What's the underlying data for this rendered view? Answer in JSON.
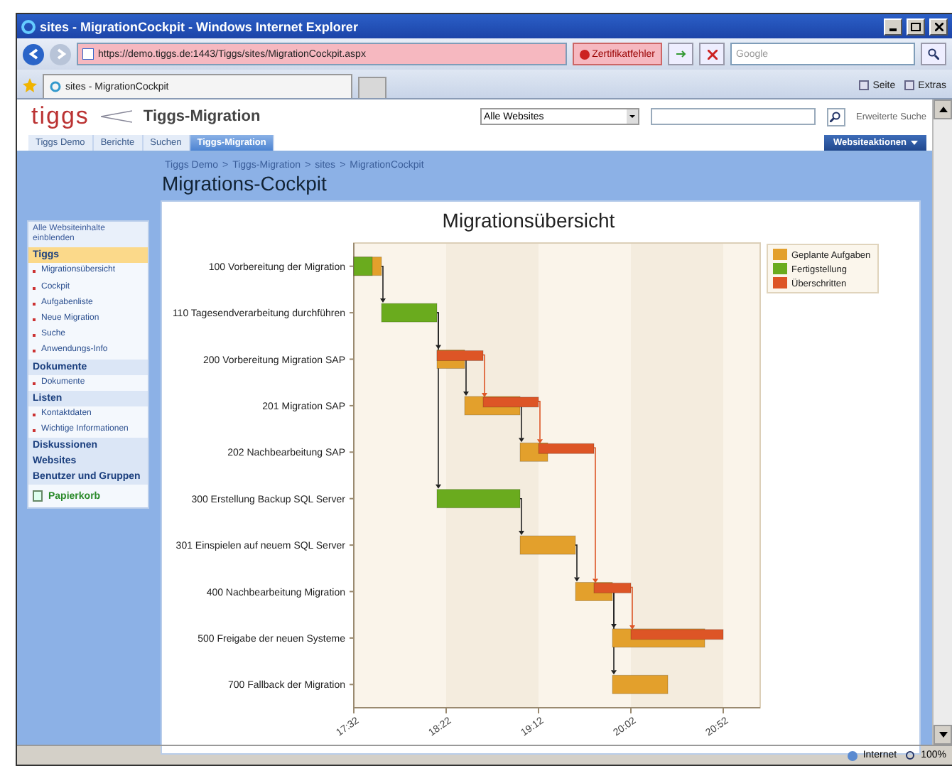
{
  "window": {
    "title": "sites - MigrationCockpit - Windows Internet Explorer"
  },
  "address_bar": {
    "url": "https://demo.tiggs.de:1443/Tiggs/sites/MigrationCockpit.aspx",
    "cert_error": "Zertifikatfehler",
    "search_placeholder": "Google"
  },
  "browser_tab": {
    "title": "sites - MigrationCockpit"
  },
  "command_bar": [
    "Seite",
    "Extras"
  ],
  "site": {
    "logo": "tiggs",
    "title": "Tiggs-Migration",
    "scope": "Alle Websites",
    "advanced_search": "Erweiterte Suche",
    "site_actions": "Websiteaktionen"
  },
  "site_tabs": [
    {
      "label": "Tiggs Demo",
      "selected": false
    },
    {
      "label": "Berichte",
      "selected": false
    },
    {
      "label": "Suchen",
      "selected": false
    },
    {
      "label": "Tiggs-Migration",
      "selected": true
    }
  ],
  "breadcrumb": {
    "separator": ">",
    "items": [
      "Tiggs Demo",
      "Tiggs-Migration",
      "sites",
      "MigrationCockpit"
    ]
  },
  "page_title": "Migrations-Cockpit",
  "sidebar": {
    "view_all": "Alle Websiteinhalte einblenden",
    "sections": [
      {
        "title": "Tiggs",
        "selected": true,
        "items": [
          "Migrationsübersicht",
          "Cockpit",
          "Aufgabenliste",
          "Neue Migration",
          "Suche",
          "Anwendungs-Info"
        ]
      },
      {
        "title": "Dokumente",
        "selected": false,
        "items": [
          "Dokumente"
        ]
      },
      {
        "title": "Listen",
        "selected": false,
        "items": [
          "Kontaktdaten",
          "Wichtige Informationen"
        ]
      },
      {
        "title": "Diskussionen",
        "selected": false
      },
      {
        "title": "Websites",
        "selected": false
      },
      {
        "title": "Benutzer und Gruppen",
        "selected": false
      }
    ],
    "recycle_bin": "Papierkorb"
  },
  "chart": {
    "title": "Migrationsübersicht",
    "ticks": [
      "17:32",
      "18:22",
      "19:12",
      "20:02",
      "20:52"
    ],
    "legend": [
      {
        "kind": "planned",
        "label": "Geplante Aufgaben",
        "color": "#e3a02c"
      },
      {
        "kind": "done",
        "label": "Fertigstellung",
        "color": "#6aab1e"
      },
      {
        "kind": "overrun",
        "label": "Überschritten",
        "color": "#dd5526"
      }
    ],
    "tasks": [
      {
        "label": "100 Vorbereitung der Migration"
      },
      {
        "label": "110 Tagesendverarbeitung durchführen"
      },
      {
        "label": "200 Vorbereitung Migration SAP"
      },
      {
        "label": "201 Migration SAP"
      },
      {
        "label": "202 Nachbearbeitung SAP"
      },
      {
        "label": "300 Erstellung Backup SQL Server"
      },
      {
        "label": "301 Einspielen auf neuem SQL Server"
      },
      {
        "label": "400 Nachbearbeitung Migration"
      },
      {
        "label": "500 Freigabe der neuen Systeme"
      },
      {
        "label": "700 Fallback der Migration"
      }
    ]
  },
  "status_bar": {
    "zone": "Internet",
    "zoom": "100%"
  }
}
